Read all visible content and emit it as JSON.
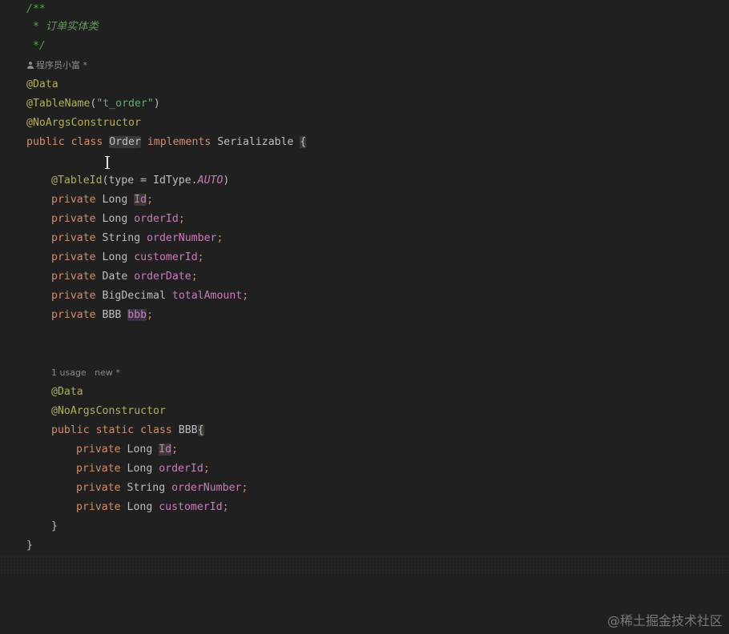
{
  "comment": {
    "open": "/**",
    "body": " * 订单实体类",
    "close": " */"
  },
  "author_hint": "程序员小富 *",
  "annotations": {
    "data": "@Data",
    "table_name": "@TableName",
    "table_name_value": "\"t_order\"",
    "no_args": "@NoArgsConstructor",
    "table_id": "@TableId",
    "table_id_args_open": "(type = IdType.",
    "table_id_const": "AUTO",
    "table_id_args_close": ")"
  },
  "order_class": {
    "modifiers": "public class ",
    "name": "Order",
    "implements_kw": " implements ",
    "iface": "Serializable ",
    "brace": "{",
    "fields": [
      {
        "mod": "private ",
        "type": "Long ",
        "name": "Id",
        "hl": true
      },
      {
        "mod": "private ",
        "type": "Long ",
        "name": "orderId"
      },
      {
        "mod": "private ",
        "type": "String ",
        "name": "orderNumber"
      },
      {
        "mod": "private ",
        "type": "Long ",
        "name": "customerId"
      },
      {
        "mod": "private ",
        "type": "Date ",
        "name": "orderDate"
      },
      {
        "mod": "private ",
        "type": "BigDecimal ",
        "name": "totalAmount"
      },
      {
        "mod": "private ",
        "type": "BBB ",
        "name": "bbb",
        "hl2": true
      }
    ]
  },
  "inner_hint": "1 usage   new *",
  "inner_class": {
    "modifiers": "public static class ",
    "name": "BBB",
    "brace": "{",
    "fields": [
      {
        "mod": "private ",
        "type": "Long ",
        "name": "Id",
        "hl": true
      },
      {
        "mod": "private ",
        "type": "Long ",
        "name": "orderId"
      },
      {
        "mod": "private ",
        "type": "String ",
        "name": "orderNumber"
      },
      {
        "mod": "private ",
        "type": "Long ",
        "name": "customerId"
      }
    ],
    "close": "}"
  },
  "outer_close": "}",
  "semicolon": ";",
  "watermark": "@稀土掘金技术社区",
  "colors": {
    "background": "#202020",
    "keyword": "#cf8e6d",
    "annotation": "#b3ae60",
    "field": "#c77dbb",
    "comment": "#5f9e55",
    "string": "#6aab73",
    "text": "#bcbec4"
  }
}
